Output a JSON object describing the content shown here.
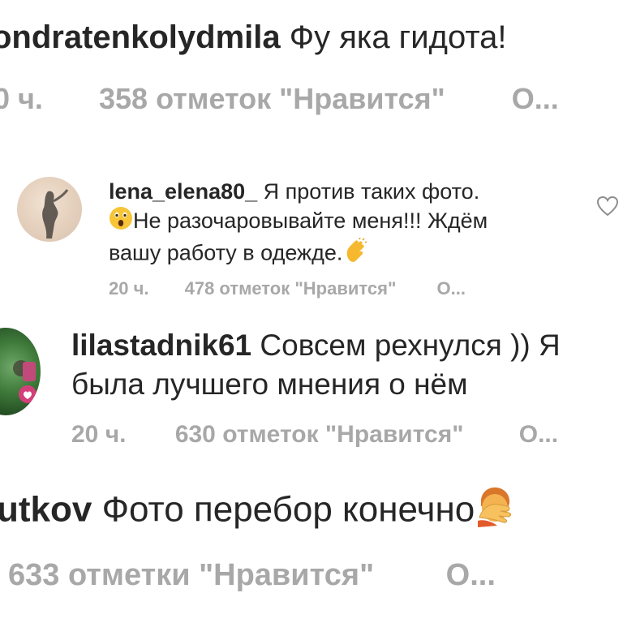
{
  "comments": [
    {
      "username": "ondratenkolydmila",
      "text": "Фу яка гидота!",
      "time": "0 ч.",
      "likes": "358 отметок \"Нравится\"",
      "reply": "О..."
    },
    {
      "username": "lena_elena80_",
      "text_line1": "Я против таких фото.",
      "text_line2": "Не разочаровывайте меня!!! Ждём",
      "text_line3": "вашу работу в одежде.",
      "emoji_before_line2": "astonished-face",
      "emoji_after_line3": "clapping-hands",
      "time": "20 ч.",
      "likes": "478 отметок \"Нравится\"",
      "reply": "О..."
    },
    {
      "username": "lilastadnik61",
      "text_line1": "Совсем рехнулся )) Я",
      "text_line2": "была лучшего мнения о нём",
      "time": "20 ч.",
      "likes": "630 отметок \"Нравится\"",
      "reply": "О..."
    },
    {
      "username": "utkov",
      "text": "Фото перебор конечно",
      "emoji_after_text": "facepalm",
      "likes": "633 отметки \"Нравится\"",
      "reply": "О..."
    }
  ],
  "colors": {
    "text": "#262626",
    "meta": "#a8a8a8",
    "background": "#ffffff"
  }
}
